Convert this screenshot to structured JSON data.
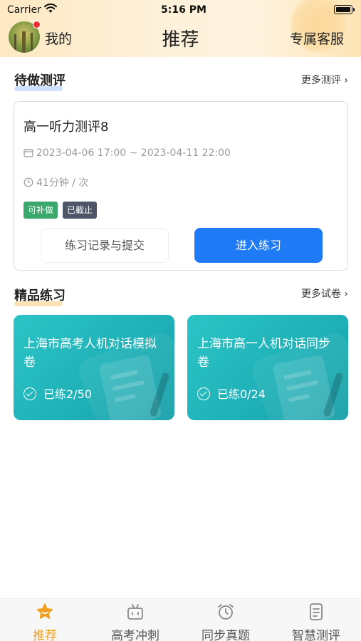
{
  "status_bar": {
    "carrier": "Carrier",
    "time": "5:16 PM"
  },
  "header": {
    "mine_label": "我的",
    "title": "推荐",
    "service_label": "专属客服"
  },
  "pending": {
    "section_title": "待做测评",
    "more_label": "更多测评",
    "task": {
      "name": "高一听力测评8",
      "time_range": "2023-04-06 17:00 ~ 2023-04-11 22:00",
      "duration": "41分钟 / 次",
      "tags": [
        {
          "label": "可补做",
          "color": "#3aa86b"
        },
        {
          "label": "已截止",
          "color": "#4d5566"
        }
      ],
      "record_button": "练习记录与提交",
      "enter_button": "进入练习"
    }
  },
  "featured": {
    "section_title": "精品练习",
    "more_label": "更多试卷",
    "cards": [
      {
        "title": "上海市高考人机对话模拟卷",
        "progress": "已练2/50"
      },
      {
        "title": "上海市高一人机对话同步卷",
        "progress": "已练0/24"
      }
    ]
  },
  "tabbar": {
    "items": [
      {
        "label": "推荐",
        "icon": "star-icon",
        "active": true
      },
      {
        "label": "高考冲刺",
        "icon": "tv-icon",
        "active": false
      },
      {
        "label": "同步真题",
        "icon": "alarm-clock-icon",
        "active": false
      },
      {
        "label": "智慧测评",
        "icon": "document-icon",
        "active": false
      }
    ]
  },
  "colors": {
    "accent": "#1f7af5",
    "tab_active": "#f0a020",
    "card_teal": "#22b8bd"
  }
}
